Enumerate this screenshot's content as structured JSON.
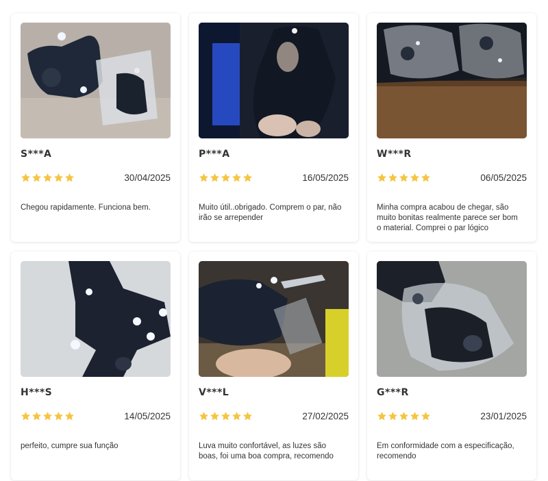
{
  "colors": {
    "star": "#F5C542",
    "text": "#333333",
    "card_bg": "#FFFFFF"
  },
  "reviews": [
    {
      "reviewer": "S***A",
      "rating": 5,
      "date": "30/04/2025",
      "text": "Chegou rapidamente. Funciona bem.",
      "photo_icon": "led-glove-photo"
    },
    {
      "reviewer": "P***A",
      "rating": 5,
      "date": "16/05/2025",
      "text": "Muito útil..obrigado. Comprem o par, não irão se arrepender",
      "photo_icon": "led-glove-photo"
    },
    {
      "reviewer": "W***R",
      "rating": 5,
      "date": "06/05/2025",
      "text": "Minha compra acabou de chegar, são muito bonitas realmente parece ser bom o material. Comprei o par lógico",
      "photo_icon": "led-glove-photo"
    },
    {
      "reviewer": "H***S",
      "rating": 5,
      "date": "14/05/2025",
      "text": "perfeito, cumpre sua função",
      "photo_icon": "led-glove-photo"
    },
    {
      "reviewer": "V***L",
      "rating": 5,
      "date": "27/02/2025",
      "text": "Luva muito confortável, as luzes são boas, foi uma boa compra, recomendo",
      "photo_icon": "led-glove-photo"
    },
    {
      "reviewer": "G***R",
      "rating": 5,
      "date": "23/01/2025",
      "text": "Em conformidade com a especificação, recomendo",
      "photo_icon": "led-glove-photo"
    }
  ]
}
